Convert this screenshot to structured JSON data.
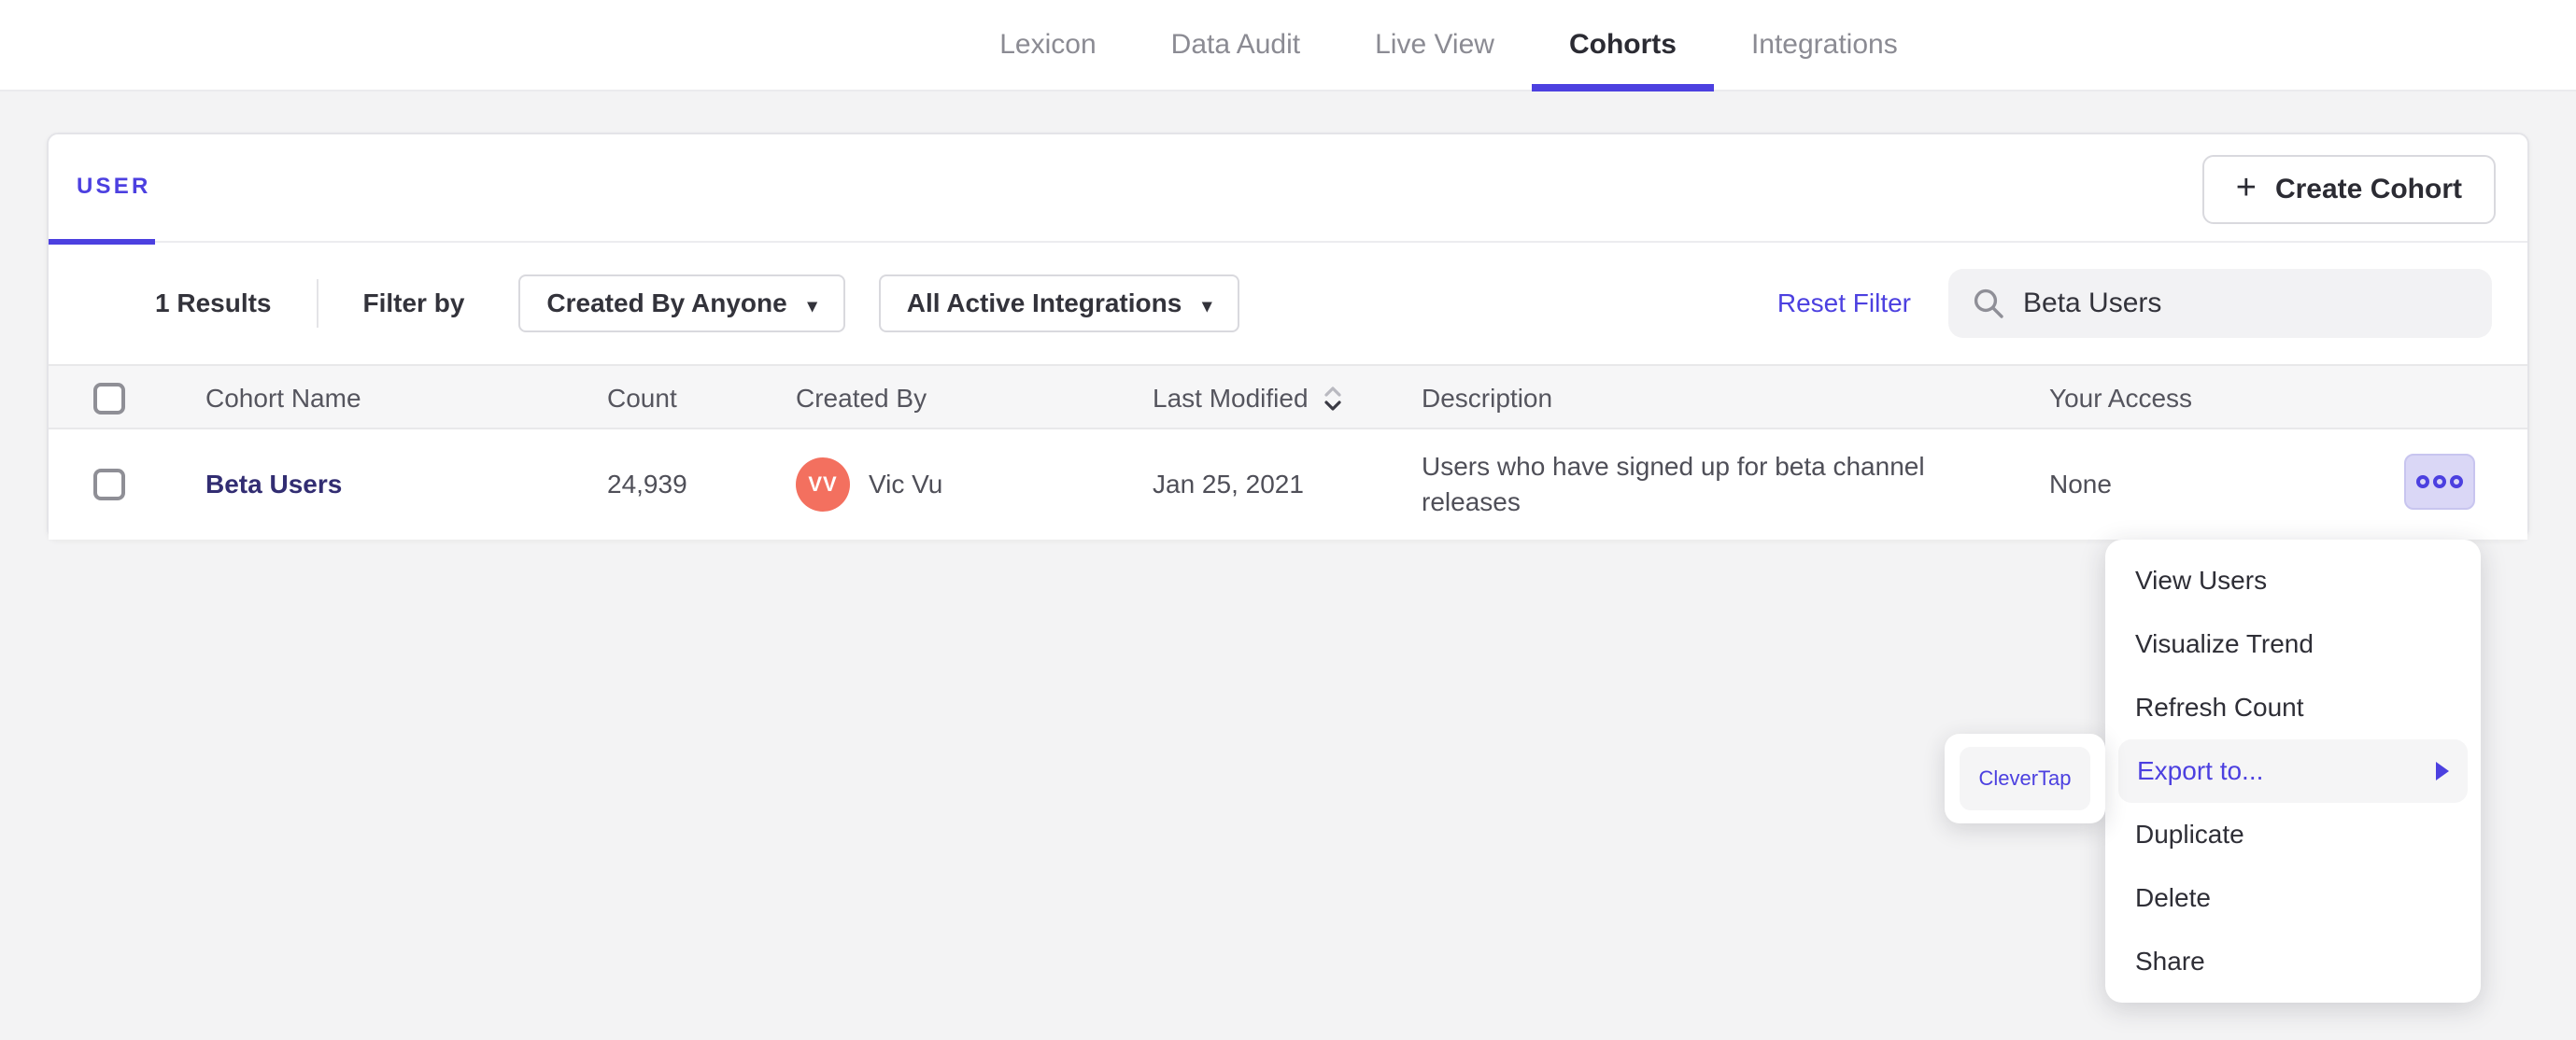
{
  "nav": {
    "tabs": [
      {
        "label": "Lexicon",
        "active": false
      },
      {
        "label": "Data Audit",
        "active": false
      },
      {
        "label": "Live View",
        "active": false
      },
      {
        "label": "Cohorts",
        "active": true
      },
      {
        "label": "Integrations",
        "active": false
      }
    ]
  },
  "card": {
    "tab_label": "USER",
    "create_button_label": "Create Cohort",
    "create_button_icon": "plus-icon",
    "filters": {
      "results_count": "1 Results",
      "filter_by_label": "Filter by",
      "created_by_dropdown": "Created By Anyone",
      "integrations_dropdown": "All Active Integrations",
      "reset_filter_label": "Reset Filter",
      "search": {
        "icon": "search-icon",
        "value": "Beta Users",
        "placeholder": ""
      }
    },
    "table": {
      "columns": [
        "Cohort Name",
        "Count",
        "Created By",
        "Last Modified",
        "Description",
        "Your Access"
      ],
      "sorted_column": "Last Modified",
      "sort_icon": "sort-chevrons-icon",
      "rows": [
        {
          "name": "Beta Users",
          "count": "24,939",
          "creator_initials": "VV",
          "creator_name": "Vic Vu",
          "last_modified": "Jan 25, 2021",
          "description": "Users who have signed up for beta channel releases",
          "your_access": "None",
          "actions_icon": "kebab-menu-icon"
        }
      ]
    }
  },
  "context_menu": {
    "items": [
      "View Users",
      "Visualize Trend",
      "Refresh Count",
      "Export to...",
      "Duplicate",
      "Delete",
      "Share"
    ],
    "highlighted_item": "Export to...",
    "submenu_items": [
      "CleverTap"
    ]
  },
  "colors": {
    "accent": "#4C40E0",
    "link_dark": "#322D72",
    "avatar": "#F3705F",
    "kebab_bg": "#DAD7F6",
    "menu_highlight_bg": "#F5F5F6",
    "page_bg": "#F3F3F4"
  }
}
